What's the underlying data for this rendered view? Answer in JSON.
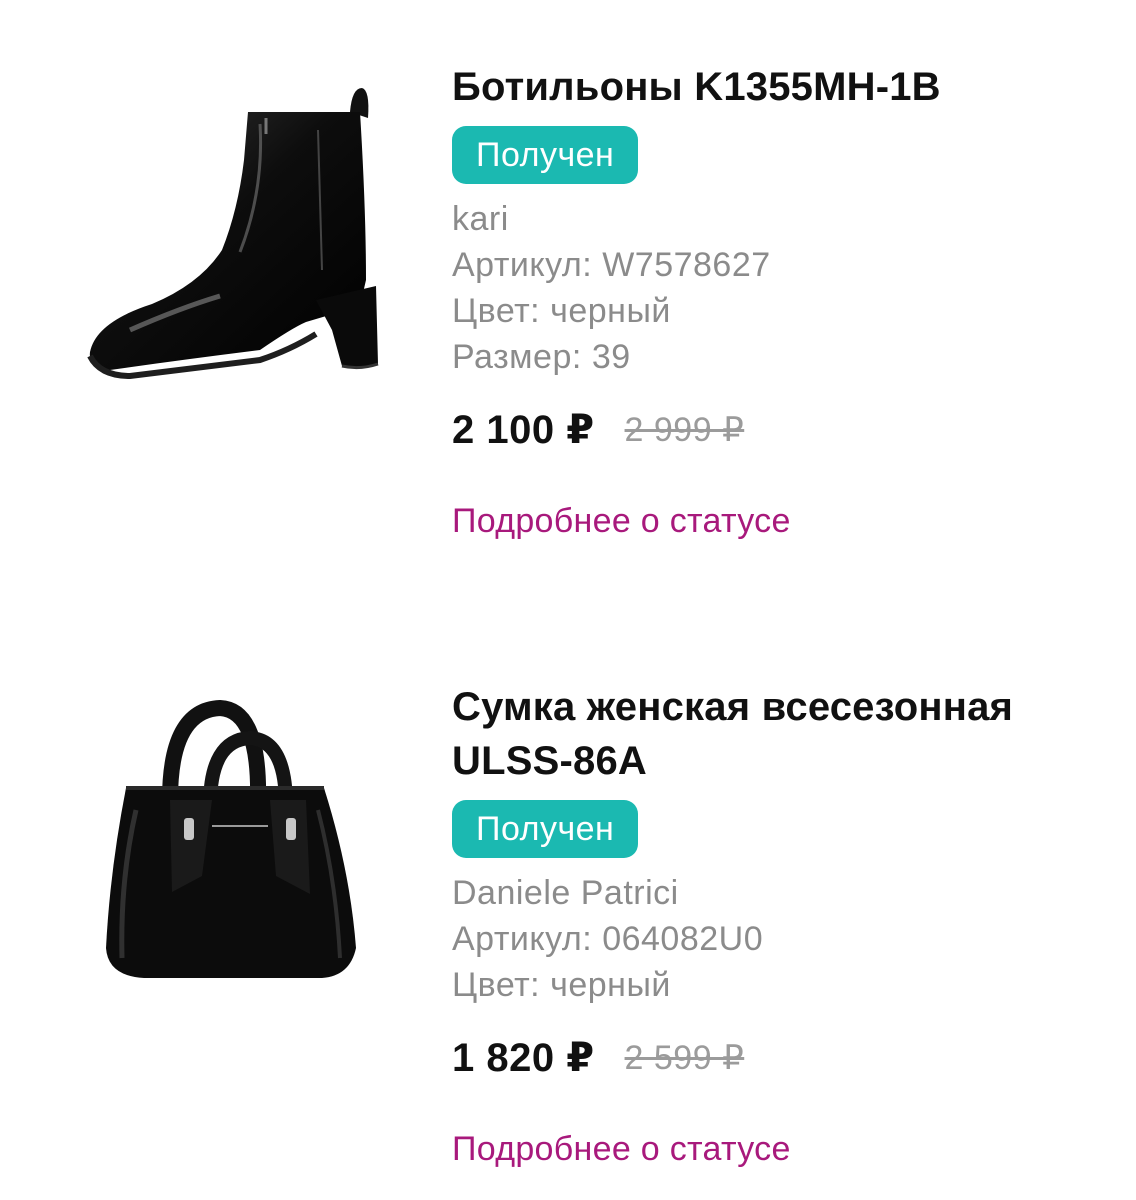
{
  "items": [
    {
      "title": "Ботильоны K1355MH-1B",
      "status_badge": "Получен",
      "brand": "kari",
      "article_label": "Артикул:",
      "article_value": "W7578627",
      "color_label": "Цвет:",
      "color_value": "черный",
      "size_label": "Размер:",
      "size_value": "39",
      "price_current": "2 100 ₽",
      "price_old": "2 999 ₽",
      "status_link": "Подробнее о статусе"
    },
    {
      "title": "Сумка женская всесезонная ULSS-86A",
      "status_badge": "Получен",
      "brand": "Daniele Patrici",
      "article_label": "Артикул:",
      "article_value": "064082U0",
      "color_label": "Цвет:",
      "color_value": "черный",
      "price_current": "1 820 ₽",
      "price_old": "2 599 ₽",
      "status_link": "Подробнее о статусе"
    }
  ],
  "colors": {
    "badge_bg": "#1bb9b1",
    "link": "#a8197c",
    "meta_text": "#8b8b8b"
  },
  "icons": {
    "item_0_image": "ankle-boot-product-image",
    "item_1_image": "handbag-product-image"
  }
}
